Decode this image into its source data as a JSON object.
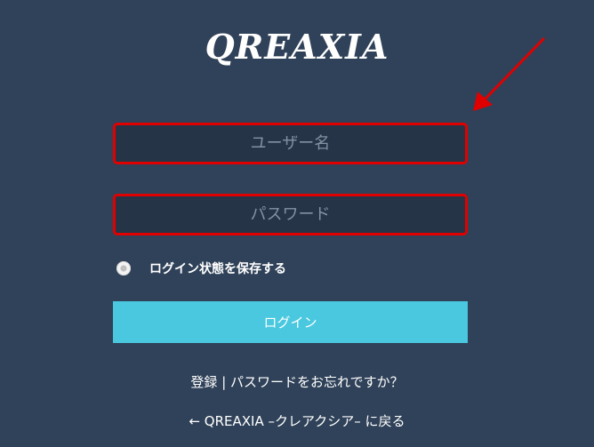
{
  "brand": {
    "logo_text": "QREAXIA"
  },
  "form": {
    "username_placeholder": "ユーザー名",
    "password_placeholder": "パスワード",
    "remember_label": "ログイン状態を保存する",
    "login_button": "ログイン"
  },
  "links": {
    "register": "登録",
    "separator": "|",
    "forgot_password": "パスワードをお忘れですか？",
    "back_to_site": "← QREAXIA –クレアクシア– に戻る"
  },
  "colors": {
    "background": "#304259",
    "field_background": "#253447",
    "highlight_border": "#e00000",
    "button": "#49c8df",
    "annotation_arrow": "#e00000"
  }
}
